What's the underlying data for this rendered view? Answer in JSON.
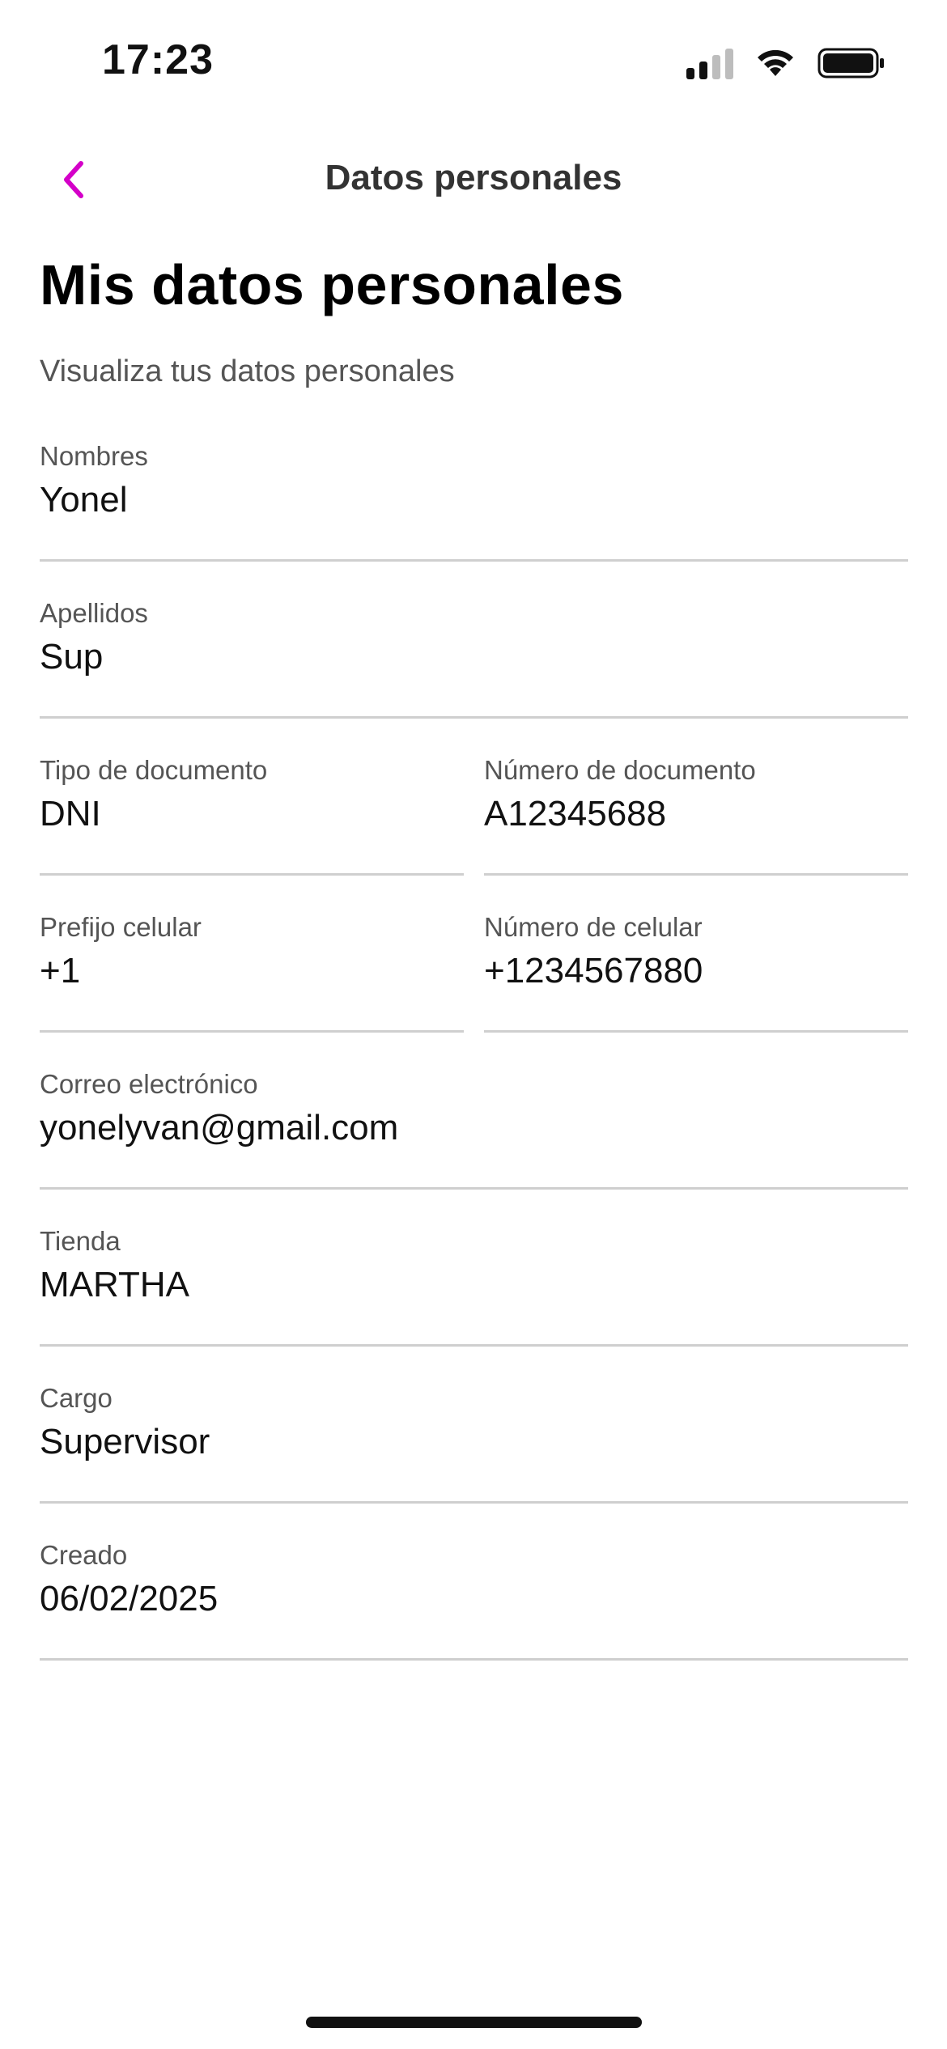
{
  "status_bar": {
    "time": "17:23"
  },
  "nav": {
    "title": "Datos personales",
    "back_icon": "chevron-left-icon",
    "accent_color": "#d400c8"
  },
  "header": {
    "title": "Mis datos personales",
    "subtitle": "Visualiza tus datos personales"
  },
  "fields": {
    "nombres": {
      "label": "Nombres",
      "value": "Yonel"
    },
    "apellidos": {
      "label": "Apellidos",
      "value": "Sup"
    },
    "tipo_documento": {
      "label": "Tipo de documento",
      "value": "DNI"
    },
    "numero_documento": {
      "label": "Número de documento",
      "value": "A12345688"
    },
    "prefijo_celular": {
      "label": "Prefijo celular",
      "value": "+1"
    },
    "numero_celular": {
      "label": "Número de celular",
      "value": "+1234567880"
    },
    "correo": {
      "label": "Correo electrónico",
      "value": "yonelyvan@gmail.com"
    },
    "tienda": {
      "label": "Tienda",
      "value": "MARTHA"
    },
    "cargo": {
      "label": "Cargo",
      "value": "Supervisor"
    },
    "creado": {
      "label": "Creado",
      "value": "06/02/2025"
    }
  }
}
